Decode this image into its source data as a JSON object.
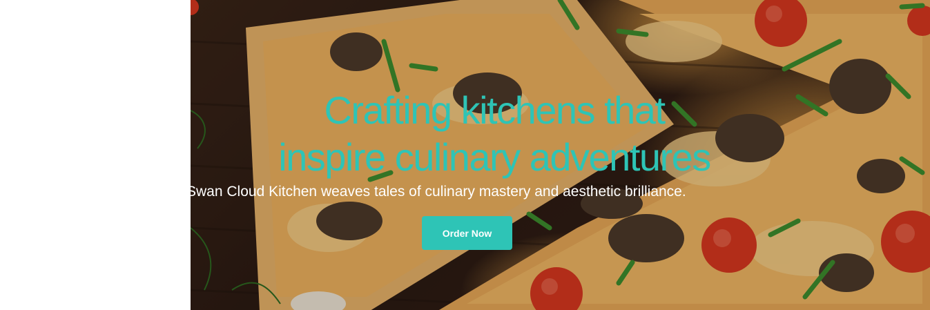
{
  "hero": {
    "title_line1": "Crafting kitchens that",
    "title_line2": "inspire culinary adventures",
    "subtitle": "Swan Cloud Kitchen weaves tales of culinary mastery and aesthetic brilliance.",
    "cta_label": "Order Now"
  },
  "colors": {
    "accent": "#2ec4b6",
    "subtitle_text": "#ffffff",
    "page_background": "#ffffff"
  },
  "background_image": {
    "name": "pizza-photo"
  }
}
